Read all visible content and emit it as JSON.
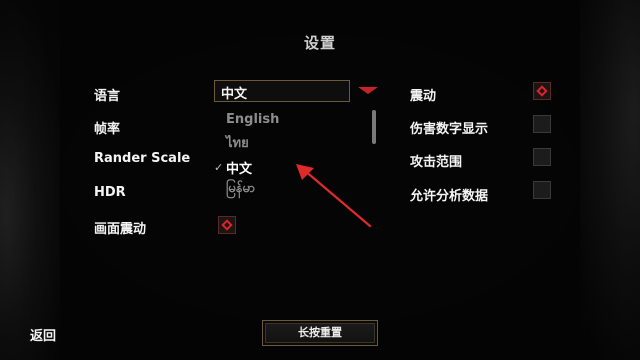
{
  "title": "设置",
  "left_labels": {
    "language": "语言",
    "framerate": "帧率",
    "render_scale": "Rander Scale",
    "hdr": "HDR",
    "screen_shake": "画面震动"
  },
  "language_dropdown": {
    "selected": "中文",
    "options": [
      "English",
      "ไทย",
      "中文",
      "မြန်မာ"
    ],
    "checkmark": "✓"
  },
  "right_labels": {
    "vibration": "震动",
    "damage_numbers": "伤害数字显示",
    "attack_range": "攻击范围",
    "analytics": "允许分析数据"
  },
  "toggles": {
    "screen_shake": true,
    "vibration": true,
    "damage_numbers": false,
    "attack_range": false,
    "analytics": false
  },
  "footer": {
    "back": "返回",
    "reset": "长按重置"
  },
  "colors": {
    "accent": "#e0232b",
    "frame": "#6b5a3a",
    "annotation_arrow": "#e02a2a"
  }
}
